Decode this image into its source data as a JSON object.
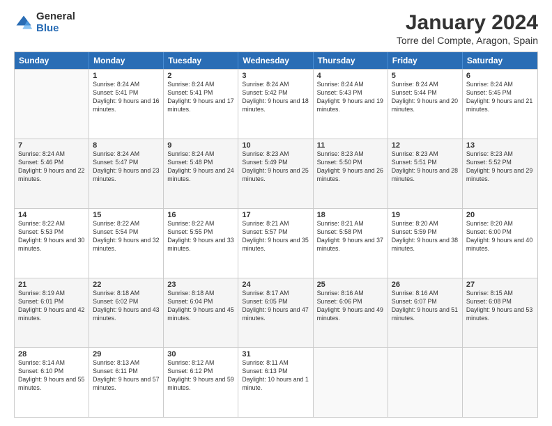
{
  "logo": {
    "general": "General",
    "blue": "Blue"
  },
  "title": "January 2024",
  "location": "Torre del Compte, Aragon, Spain",
  "header_days": [
    "Sunday",
    "Monday",
    "Tuesday",
    "Wednesday",
    "Thursday",
    "Friday",
    "Saturday"
  ],
  "weeks": [
    [
      {
        "day": "",
        "sunrise": "",
        "sunset": "",
        "daylight": ""
      },
      {
        "day": "1",
        "sunrise": "Sunrise: 8:24 AM",
        "sunset": "Sunset: 5:41 PM",
        "daylight": "Daylight: 9 hours and 16 minutes."
      },
      {
        "day": "2",
        "sunrise": "Sunrise: 8:24 AM",
        "sunset": "Sunset: 5:41 PM",
        "daylight": "Daylight: 9 hours and 17 minutes."
      },
      {
        "day": "3",
        "sunrise": "Sunrise: 8:24 AM",
        "sunset": "Sunset: 5:42 PM",
        "daylight": "Daylight: 9 hours and 18 minutes."
      },
      {
        "day": "4",
        "sunrise": "Sunrise: 8:24 AM",
        "sunset": "Sunset: 5:43 PM",
        "daylight": "Daylight: 9 hours and 19 minutes."
      },
      {
        "day": "5",
        "sunrise": "Sunrise: 8:24 AM",
        "sunset": "Sunset: 5:44 PM",
        "daylight": "Daylight: 9 hours and 20 minutes."
      },
      {
        "day": "6",
        "sunrise": "Sunrise: 8:24 AM",
        "sunset": "Sunset: 5:45 PM",
        "daylight": "Daylight: 9 hours and 21 minutes."
      }
    ],
    [
      {
        "day": "7",
        "sunrise": "Sunrise: 8:24 AM",
        "sunset": "Sunset: 5:46 PM",
        "daylight": "Daylight: 9 hours and 22 minutes."
      },
      {
        "day": "8",
        "sunrise": "Sunrise: 8:24 AM",
        "sunset": "Sunset: 5:47 PM",
        "daylight": "Daylight: 9 hours and 23 minutes."
      },
      {
        "day": "9",
        "sunrise": "Sunrise: 8:24 AM",
        "sunset": "Sunset: 5:48 PM",
        "daylight": "Daylight: 9 hours and 24 minutes."
      },
      {
        "day": "10",
        "sunrise": "Sunrise: 8:23 AM",
        "sunset": "Sunset: 5:49 PM",
        "daylight": "Daylight: 9 hours and 25 minutes."
      },
      {
        "day": "11",
        "sunrise": "Sunrise: 8:23 AM",
        "sunset": "Sunset: 5:50 PM",
        "daylight": "Daylight: 9 hours and 26 minutes."
      },
      {
        "day": "12",
        "sunrise": "Sunrise: 8:23 AM",
        "sunset": "Sunset: 5:51 PM",
        "daylight": "Daylight: 9 hours and 28 minutes."
      },
      {
        "day": "13",
        "sunrise": "Sunrise: 8:23 AM",
        "sunset": "Sunset: 5:52 PM",
        "daylight": "Daylight: 9 hours and 29 minutes."
      }
    ],
    [
      {
        "day": "14",
        "sunrise": "Sunrise: 8:22 AM",
        "sunset": "Sunset: 5:53 PM",
        "daylight": "Daylight: 9 hours and 30 minutes."
      },
      {
        "day": "15",
        "sunrise": "Sunrise: 8:22 AM",
        "sunset": "Sunset: 5:54 PM",
        "daylight": "Daylight: 9 hours and 32 minutes."
      },
      {
        "day": "16",
        "sunrise": "Sunrise: 8:22 AM",
        "sunset": "Sunset: 5:55 PM",
        "daylight": "Daylight: 9 hours and 33 minutes."
      },
      {
        "day": "17",
        "sunrise": "Sunrise: 8:21 AM",
        "sunset": "Sunset: 5:57 PM",
        "daylight": "Daylight: 9 hours and 35 minutes."
      },
      {
        "day": "18",
        "sunrise": "Sunrise: 8:21 AM",
        "sunset": "Sunset: 5:58 PM",
        "daylight": "Daylight: 9 hours and 37 minutes."
      },
      {
        "day": "19",
        "sunrise": "Sunrise: 8:20 AM",
        "sunset": "Sunset: 5:59 PM",
        "daylight": "Daylight: 9 hours and 38 minutes."
      },
      {
        "day": "20",
        "sunrise": "Sunrise: 8:20 AM",
        "sunset": "Sunset: 6:00 PM",
        "daylight": "Daylight: 9 hours and 40 minutes."
      }
    ],
    [
      {
        "day": "21",
        "sunrise": "Sunrise: 8:19 AM",
        "sunset": "Sunset: 6:01 PM",
        "daylight": "Daylight: 9 hours and 42 minutes."
      },
      {
        "day": "22",
        "sunrise": "Sunrise: 8:18 AM",
        "sunset": "Sunset: 6:02 PM",
        "daylight": "Daylight: 9 hours and 43 minutes."
      },
      {
        "day": "23",
        "sunrise": "Sunrise: 8:18 AM",
        "sunset": "Sunset: 6:04 PM",
        "daylight": "Daylight: 9 hours and 45 minutes."
      },
      {
        "day": "24",
        "sunrise": "Sunrise: 8:17 AM",
        "sunset": "Sunset: 6:05 PM",
        "daylight": "Daylight: 9 hours and 47 minutes."
      },
      {
        "day": "25",
        "sunrise": "Sunrise: 8:16 AM",
        "sunset": "Sunset: 6:06 PM",
        "daylight": "Daylight: 9 hours and 49 minutes."
      },
      {
        "day": "26",
        "sunrise": "Sunrise: 8:16 AM",
        "sunset": "Sunset: 6:07 PM",
        "daylight": "Daylight: 9 hours and 51 minutes."
      },
      {
        "day": "27",
        "sunrise": "Sunrise: 8:15 AM",
        "sunset": "Sunset: 6:08 PM",
        "daylight": "Daylight: 9 hours and 53 minutes."
      }
    ],
    [
      {
        "day": "28",
        "sunrise": "Sunrise: 8:14 AM",
        "sunset": "Sunset: 6:10 PM",
        "daylight": "Daylight: 9 hours and 55 minutes."
      },
      {
        "day": "29",
        "sunrise": "Sunrise: 8:13 AM",
        "sunset": "Sunset: 6:11 PM",
        "daylight": "Daylight: 9 hours and 57 minutes."
      },
      {
        "day": "30",
        "sunrise": "Sunrise: 8:12 AM",
        "sunset": "Sunset: 6:12 PM",
        "daylight": "Daylight: 9 hours and 59 minutes."
      },
      {
        "day": "31",
        "sunrise": "Sunrise: 8:11 AM",
        "sunset": "Sunset: 6:13 PM",
        "daylight": "Daylight: 10 hours and 1 minute."
      },
      {
        "day": "",
        "sunrise": "",
        "sunset": "",
        "daylight": ""
      },
      {
        "day": "",
        "sunrise": "",
        "sunset": "",
        "daylight": ""
      },
      {
        "day": "",
        "sunrise": "",
        "sunset": "",
        "daylight": ""
      }
    ]
  ]
}
